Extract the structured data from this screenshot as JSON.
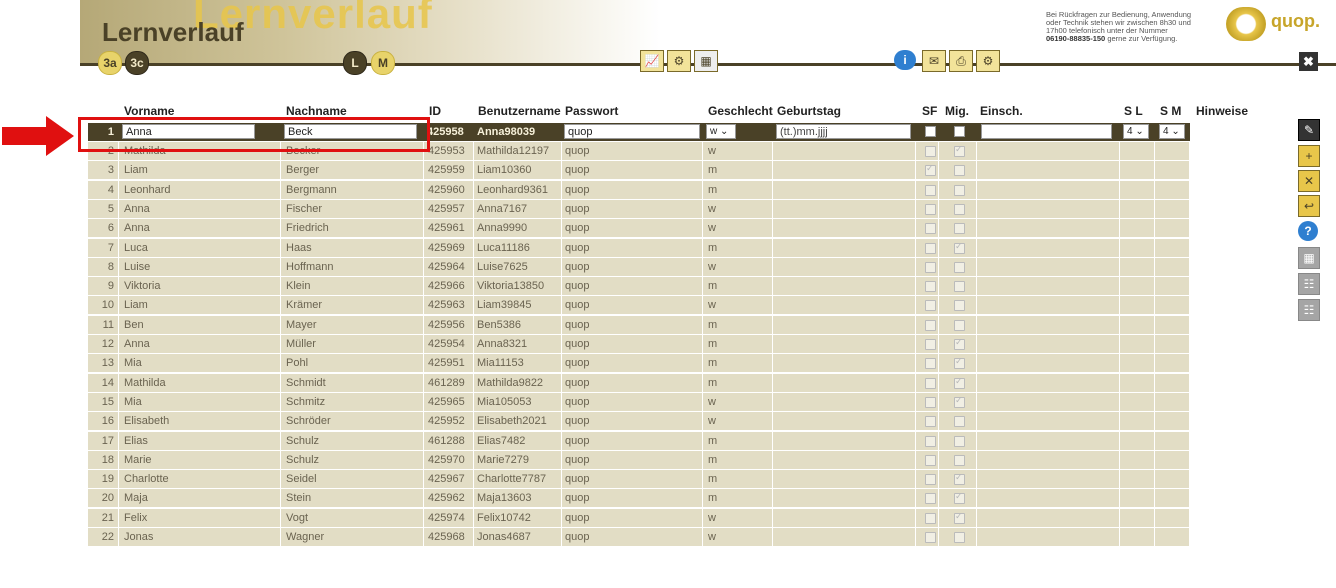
{
  "header": {
    "title": "Lernverlauf",
    "watermark": "Lernverlauf",
    "classes": [
      "3a",
      "3c"
    ],
    "levels": [
      "L",
      "M"
    ],
    "help": {
      "line1": "Bei Rückfragen zur Bedienung, Anwendung",
      "line2": "oder Technik stehen wir zwischen 8h30 und",
      "line3": "17h00 telefonisch unter der Nummer",
      "phone": "06190-88835-150",
      "line4": " gerne zur Verfügung."
    },
    "logo_text": "quop.",
    "toolbar_icons": [
      "chart-icon",
      "chart-settings-icon",
      "calculator-icon",
      "info-icon",
      "mail-icon",
      "print-icon",
      "settings-icon"
    ],
    "close_glyph": "✖"
  },
  "columns": {
    "vorname": "Vorname",
    "nachname": "Nachname",
    "id": "ID",
    "benutzername": "Benutzername",
    "passwort": "Passwort",
    "geschlecht": "Geschlecht",
    "geburtstag": "Geburtstag",
    "sf": "SF",
    "mig": "Mig.",
    "einsch": "Einsch.",
    "sl": "S L",
    "sm": "S M",
    "hinweise": "Hinweise"
  },
  "edit_row": {
    "nr": "1",
    "vorname": "Anna",
    "nachname": "Beck",
    "id": "425958",
    "benutzername": "Anna98039",
    "passwort": "quop",
    "geschlecht": "w ⌄",
    "geburtstag": "(tt.)mm.jjjj",
    "sl": "4 ⌄",
    "sm": "4 ⌄"
  },
  "rows": [
    {
      "nr": "2",
      "vorname": "Mathilda",
      "nachname": "Becker",
      "id": "425953",
      "benutzername": "Mathilda12197",
      "passwort": "quop",
      "geschlecht": "w",
      "sf": false,
      "mig": true
    },
    {
      "nr": "3",
      "vorname": "Liam",
      "nachname": "Berger",
      "id": "425959",
      "benutzername": "Liam10360",
      "passwort": "quop",
      "geschlecht": "m",
      "sf": true,
      "mig": false
    },
    {
      "nr": "4",
      "vorname": "Leonhard",
      "nachname": "Bergmann",
      "id": "425960",
      "benutzername": "Leonhard9361",
      "passwort": "quop",
      "geschlecht": "m",
      "sf": false,
      "mig": false
    },
    {
      "nr": "5",
      "vorname": "Anna",
      "nachname": "Fischer",
      "id": "425957",
      "benutzername": "Anna7167",
      "passwort": "quop",
      "geschlecht": "w",
      "sf": false,
      "mig": false
    },
    {
      "nr": "6",
      "vorname": "Anna",
      "nachname": "Friedrich",
      "id": "425961",
      "benutzername": "Anna9990",
      "passwort": "quop",
      "geschlecht": "w",
      "sf": false,
      "mig": false
    },
    {
      "nr": "7",
      "vorname": "Luca",
      "nachname": "Haas",
      "id": "425969",
      "benutzername": "Luca11186",
      "passwort": "quop",
      "geschlecht": "m",
      "sf": false,
      "mig": true
    },
    {
      "nr": "8",
      "vorname": "Luise",
      "nachname": "Hoffmann",
      "id": "425964",
      "benutzername": "Luise7625",
      "passwort": "quop",
      "geschlecht": "w",
      "sf": false,
      "mig": false
    },
    {
      "nr": "9",
      "vorname": "Viktoria",
      "nachname": "Klein",
      "id": "425966",
      "benutzername": "Viktoria13850",
      "passwort": "quop",
      "geschlecht": "m",
      "sf": false,
      "mig": false
    },
    {
      "nr": "10",
      "vorname": "Liam",
      "nachname": "Krämer",
      "id": "425963",
      "benutzername": "Liam39845",
      "passwort": "quop",
      "geschlecht": "w",
      "sf": false,
      "mig": false
    },
    {
      "nr": "11",
      "vorname": "Ben",
      "nachname": "Mayer",
      "id": "425956",
      "benutzername": "Ben5386",
      "passwort": "quop",
      "geschlecht": "m",
      "sf": false,
      "mig": false
    },
    {
      "nr": "12",
      "vorname": "Anna",
      "nachname": "Müller",
      "id": "425954",
      "benutzername": "Anna8321",
      "passwort": "quop",
      "geschlecht": "m",
      "sf": false,
      "mig": true
    },
    {
      "nr": "13",
      "vorname": "Mia",
      "nachname": "Pohl",
      "id": "425951",
      "benutzername": "Mia11153",
      "passwort": "quop",
      "geschlecht": "m",
      "sf": false,
      "mig": true
    },
    {
      "nr": "14",
      "vorname": "Mathilda",
      "nachname": "Schmidt",
      "id": "461289",
      "benutzername": "Mathilda9822",
      "passwort": "quop",
      "geschlecht": "m",
      "sf": false,
      "mig": true
    },
    {
      "nr": "15",
      "vorname": "Mia",
      "nachname": "Schmitz",
      "id": "425965",
      "benutzername": "Mia105053",
      "passwort": "quop",
      "geschlecht": "w",
      "sf": false,
      "mig": true
    },
    {
      "nr": "16",
      "vorname": "Elisabeth",
      "nachname": "Schröder",
      "id": "425952",
      "benutzername": "Elisabeth2021",
      "passwort": "quop",
      "geschlecht": "w",
      "sf": false,
      "mig": false
    },
    {
      "nr": "17",
      "vorname": "Elias",
      "nachname": "Schulz",
      "id": "461288",
      "benutzername": "Elias7482",
      "passwort": "quop",
      "geschlecht": "m",
      "sf": false,
      "mig": false
    },
    {
      "nr": "18",
      "vorname": "Marie",
      "nachname": "Schulz",
      "id": "425970",
      "benutzername": "Marie7279",
      "passwort": "quop",
      "geschlecht": "m",
      "sf": false,
      "mig": false
    },
    {
      "nr": "19",
      "vorname": "Charlotte",
      "nachname": "Seidel",
      "id": "425967",
      "benutzername": "Charlotte7787",
      "passwort": "quop",
      "geschlecht": "m",
      "sf": false,
      "mig": true
    },
    {
      "nr": "20",
      "vorname": "Maja",
      "nachname": "Stein",
      "id": "425962",
      "benutzername": "Maja13603",
      "passwort": "quop",
      "geschlecht": "m",
      "sf": false,
      "mig": true
    },
    {
      "nr": "21",
      "vorname": "Felix",
      "nachname": "Vogt",
      "id": "425974",
      "benutzername": "Felix10742",
      "passwort": "quop",
      "geschlecht": "w",
      "sf": false,
      "mig": true
    },
    {
      "nr": "22",
      "vorname": "Jonas",
      "nachname": "Wagner",
      "id": "425968",
      "benutzername": "Jonas4687",
      "passwort": "quop",
      "geschlecht": "w",
      "sf": false,
      "mig": false
    }
  ],
  "side_icons": [
    "edit-list-icon",
    "add-student-icon",
    "remove-student-icon",
    "move-student-icon",
    "help-icon",
    "grid-icon",
    "group-icon",
    "group-alt-icon"
  ],
  "colors": {
    "accent": "#e8c64a",
    "dark": "#4a4127",
    "row_bg": "#e2ddc5",
    "highlight": "#e01010"
  }
}
